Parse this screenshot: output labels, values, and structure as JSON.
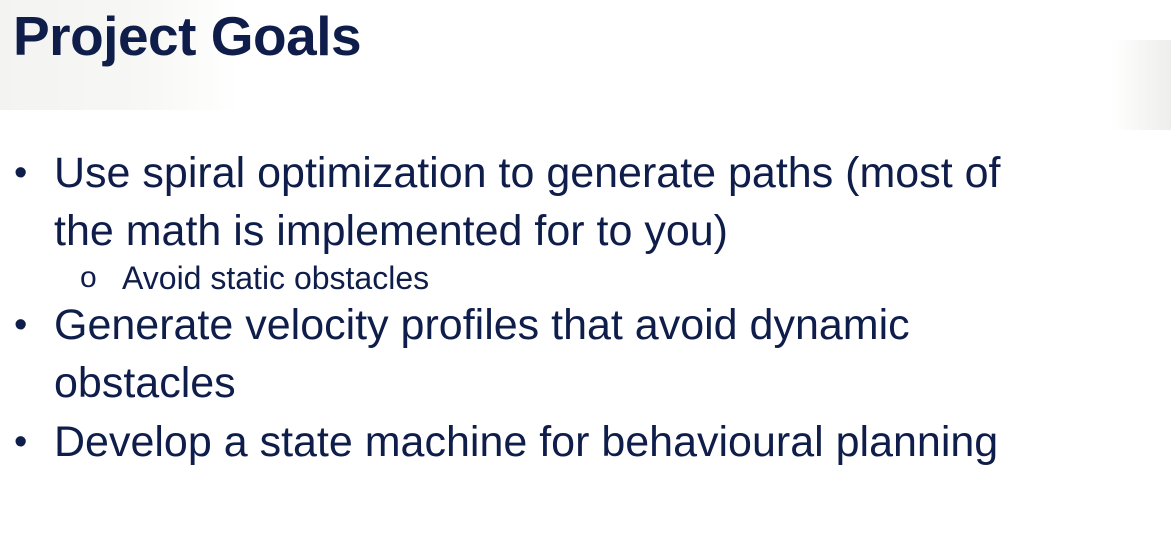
{
  "slide": {
    "title": "Project Goals",
    "bullets": [
      {
        "line1": "Use spiral optimization to generate paths (most of",
        "line2": "the math is implemented for to you)",
        "sub_items": [
          "Avoid static obstacles"
        ]
      },
      {
        "line1": "Generate velocity profiles that avoid dynamic",
        "line2": "obstacles",
        "sub_items": []
      },
      {
        "line1": "Develop a state machine for behavioural planning",
        "line2": "",
        "sub_items": []
      }
    ],
    "bullet_marker": "•",
    "sub_marker": "o"
  }
}
